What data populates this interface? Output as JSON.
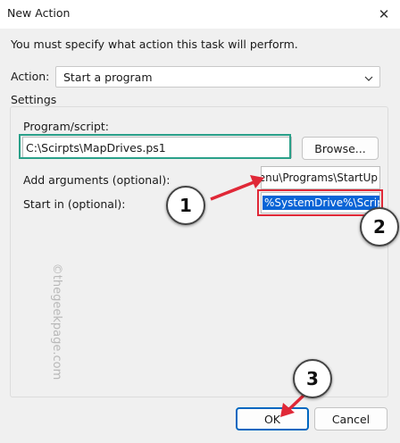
{
  "window": {
    "title": "New Action"
  },
  "dialog": {
    "instruction": "You must specify what action this task will perform.",
    "action_label": "Action:",
    "action_value": "Start a program",
    "settings_label": "Settings",
    "program_label": "Program/script:",
    "program_value": "C:\\Scirpts\\MapDrives.ps1",
    "browse_label": "Browse...",
    "args_label": "Add arguments (optional):",
    "args_value": "Menu\\Programs\\StartUp",
    "start_label": "Start in (optional):",
    "start_value": "%SystemDrive%\\Scripts\\",
    "ok_label": "OK",
    "cancel_label": "Cancel"
  },
  "watermark": "©thegeekpage.com",
  "annotations": {
    "step1": "1",
    "step2": "2",
    "step3": "3"
  },
  "colors": {
    "dialog_bg": "#f0f0f0",
    "highlight_green": "#2aa089",
    "highlight_red": "#e02837",
    "arrow_red": "#e02837",
    "selection_blue": "#0a64d6",
    "default_button_border": "#0067c0"
  }
}
